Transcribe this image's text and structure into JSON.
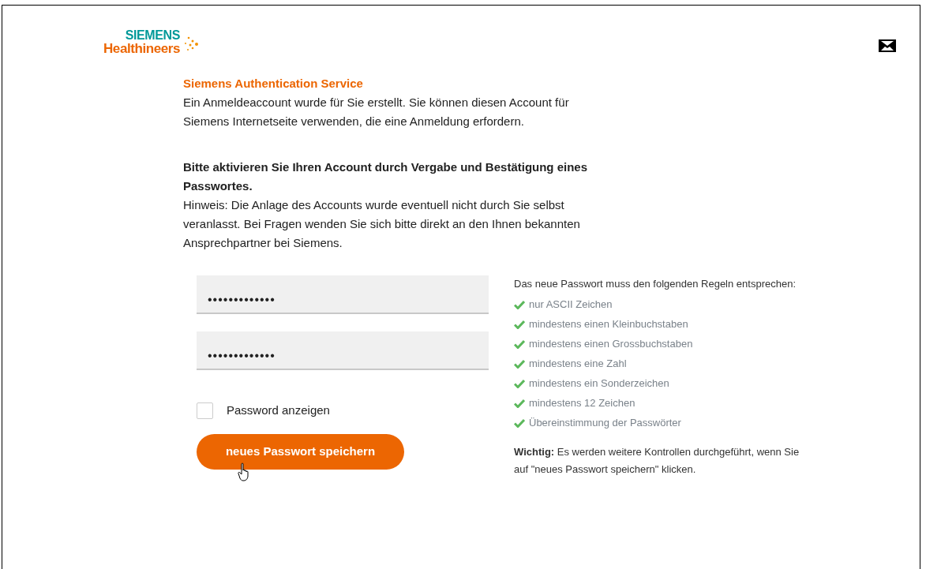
{
  "logo": {
    "line_1": "SIEMENS",
    "line_2": "Healthineers"
  },
  "service_title": "Siemens Authentication Service",
  "intro": "Ein Anmeldeaccount wurde für Sie erstellt. Sie können diesen Account für Siemens Internetseite verwenden, die eine Anmeldung erfordern.",
  "activation_heading": "Bitte aktivieren Sie Ihren Account durch Vergabe und Bestätigung eines Passwortes.",
  "hint": "Hinweis: Die Anlage des Accounts wurde eventuell nicht durch Sie selbst veranlasst. Bei Fragen wenden Sie sich bitte direkt an den Ihnen bekannten Ansprechpartner bei Siemens.",
  "password_fields": [
    {
      "value": "•••••••••••••"
    },
    {
      "value": "•••••••••••••"
    }
  ],
  "show_password": {
    "label": "Password anzeigen",
    "checked": false
  },
  "save_button": "neues Passwort speichern",
  "rules_intro": "Das neue Passwort muss den folgenden Regeln entsprechen:",
  "rules": [
    {
      "label": "nur ASCII Zeichen",
      "met": true
    },
    {
      "label": "mindestens einen Kleinbuchstaben",
      "met": true
    },
    {
      "label": "mindestens einen Grossbuchstaben",
      "met": true
    },
    {
      "label": "mindestens eine Zahl",
      "met": true
    },
    {
      "label": "mindestens ein Sonderzeichen",
      "met": true
    },
    {
      "label": "mindestens 12 Zeichen",
      "met": true
    },
    {
      "label": "Übereinstimmung der Passwörter",
      "met": true
    }
  ],
  "note": "**Wichtig:** Es werden weitere Kontrollen durchgeführt, wenn Sie auf \"neues Passwort speichern\" klicken."
}
